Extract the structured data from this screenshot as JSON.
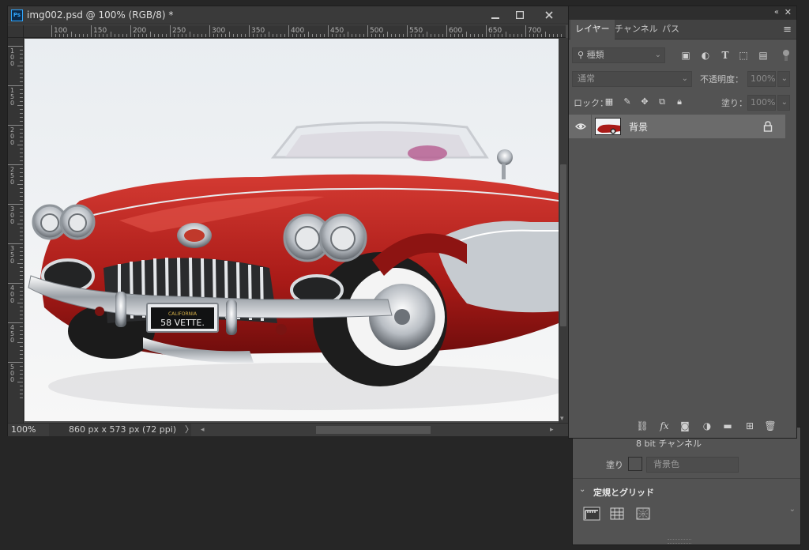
{
  "document": {
    "title": "img002.psd @ 100% (RGB/8) *",
    "app_badge": "Ps",
    "ruler_h_labels": [
      "100",
      "150",
      "200",
      "250",
      "300",
      "350",
      "400",
      "450",
      "500",
      "550",
      "600",
      "650",
      "700"
    ],
    "ruler_v_labels": [
      "100",
      "150",
      "200",
      "250",
      "300",
      "350",
      "400",
      "450",
      "500"
    ],
    "zoom": "100%",
    "info": "860 px x 573 px (72 ppi)",
    "info_arrow": "〉",
    "plate_text": "58 VETTE.",
    "plate_state": "CALIFORNIA"
  },
  "layers_panel": {
    "tabs": [
      "レイヤー",
      "チャンネル",
      "パス"
    ],
    "active_tab": 0,
    "search_placeholder": "種類",
    "blend_mode": "通常",
    "opacity_label": "不透明度：",
    "opacity_value": "100%",
    "lock_label": "ロック：",
    "fill_label": "塗り：",
    "fill_value": "100%",
    "layer": {
      "name": "背景",
      "visible": true,
      "locked": true
    },
    "icons": {
      "filters": [
        "image-filter-icon",
        "adjustment-filter-icon",
        "type-filter-icon",
        "shape-filter-icon",
        "smart-object-filter-icon"
      ],
      "locks": [
        "lock-transparent-icon",
        "lock-paint-icon",
        "lock-move-icon",
        "lock-artboard-icon",
        "lock-all-icon"
      ],
      "footer": [
        "link-layers-icon",
        "fx-icon",
        "mask-icon",
        "adjustment-layer-icon",
        "group-icon",
        "new-layer-icon",
        "delete-icon"
      ]
    }
  },
  "properties_panel": {
    "cut_text": "8 bit チャンネル",
    "fill_label": "塗り",
    "fill_select": "背景色",
    "section_title": "定規とグリッド"
  },
  "colors": {
    "app_bg": "#262626",
    "panel_bg": "#535353",
    "accent_ps": "#31a8ff",
    "car_red": "#b3201c"
  }
}
